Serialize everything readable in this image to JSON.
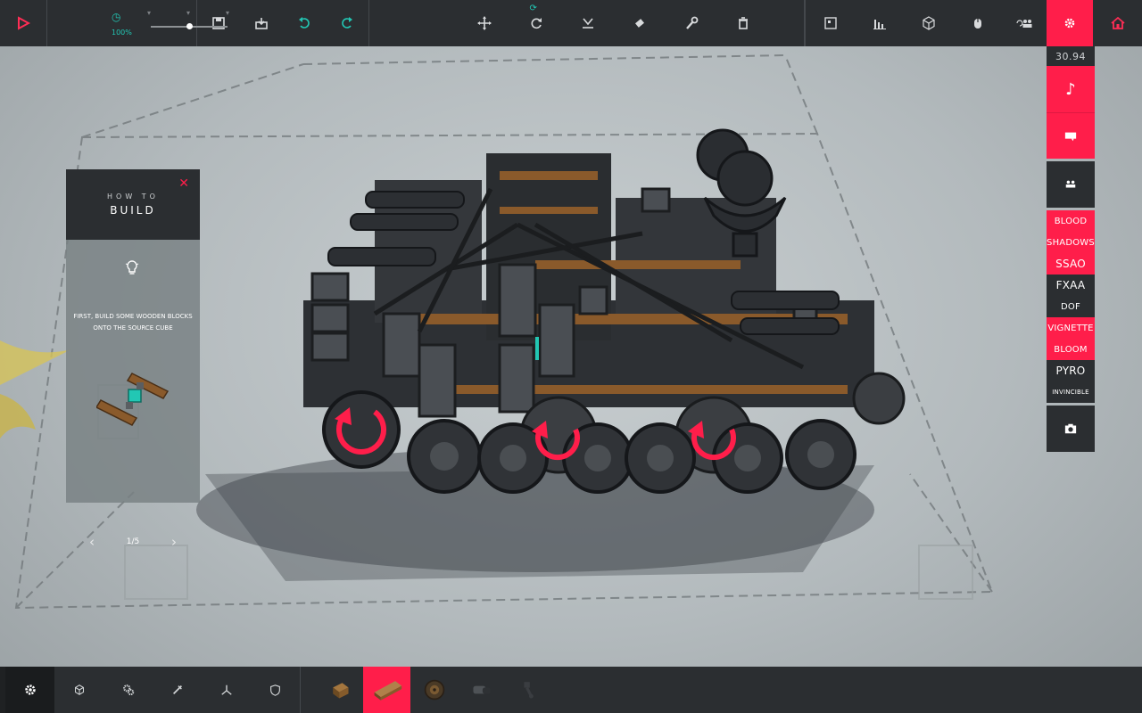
{
  "toolbar": {
    "speed_label": "100%",
    "buttons": {
      "play": "play-icon",
      "save": "save-icon",
      "load": "load-icon",
      "undo": "undo-icon",
      "redo": "redo-icon",
      "move": "move-icon",
      "rotate": "rotate-icon",
      "flip": "flip-icon",
      "eraser": "eraser-icon",
      "wrench": "wrench-icon",
      "delete": "trash-icon",
      "frame": "frame-icon",
      "stats": "stats-icon",
      "cube": "cube-icon",
      "mouse": "mouse-icon",
      "multiplayer": "multiplayer-icon",
      "settings": "gear-icon",
      "home": "home-icon"
    },
    "speed_fraction": 0.5
  },
  "side_panel": {
    "timer": "30.94",
    "toggles": [
      {
        "label": "BLOOD",
        "active": true
      },
      {
        "label": "SHADOWS",
        "active": true
      },
      {
        "label": "SSAO",
        "active": true
      },
      {
        "label": "FXAA",
        "active": false
      },
      {
        "label": "DOF",
        "active": false
      },
      {
        "label": "VIGNETTE",
        "active": true
      },
      {
        "label": "BLOOM",
        "active": true
      },
      {
        "label": "PYRO",
        "active": false
      },
      {
        "label": "INVINCIBLE",
        "active": false
      }
    ]
  },
  "howto": {
    "sub": "HOW TO",
    "title": "BUILD",
    "text": "FIRST, BUILD SOME WOODEN BLOCKS ONTO THE SOURCE CUBE",
    "page": "1/5",
    "prev": "‹",
    "next": "›",
    "close": "✕"
  },
  "bottombar": {
    "categories": [
      "gear-icon",
      "cube-icon",
      "cogs-icon",
      "weapon-icon",
      "flight-icon",
      "armour-icon"
    ],
    "blocks": [
      "wooden-block",
      "wooden-pole-selected",
      "wheel-block",
      "hinge-block",
      "joint-block"
    ]
  },
  "colors": {
    "accent": "#ff1e4a",
    "panel": "#2b2e31",
    "teal": "#22c7b4"
  }
}
